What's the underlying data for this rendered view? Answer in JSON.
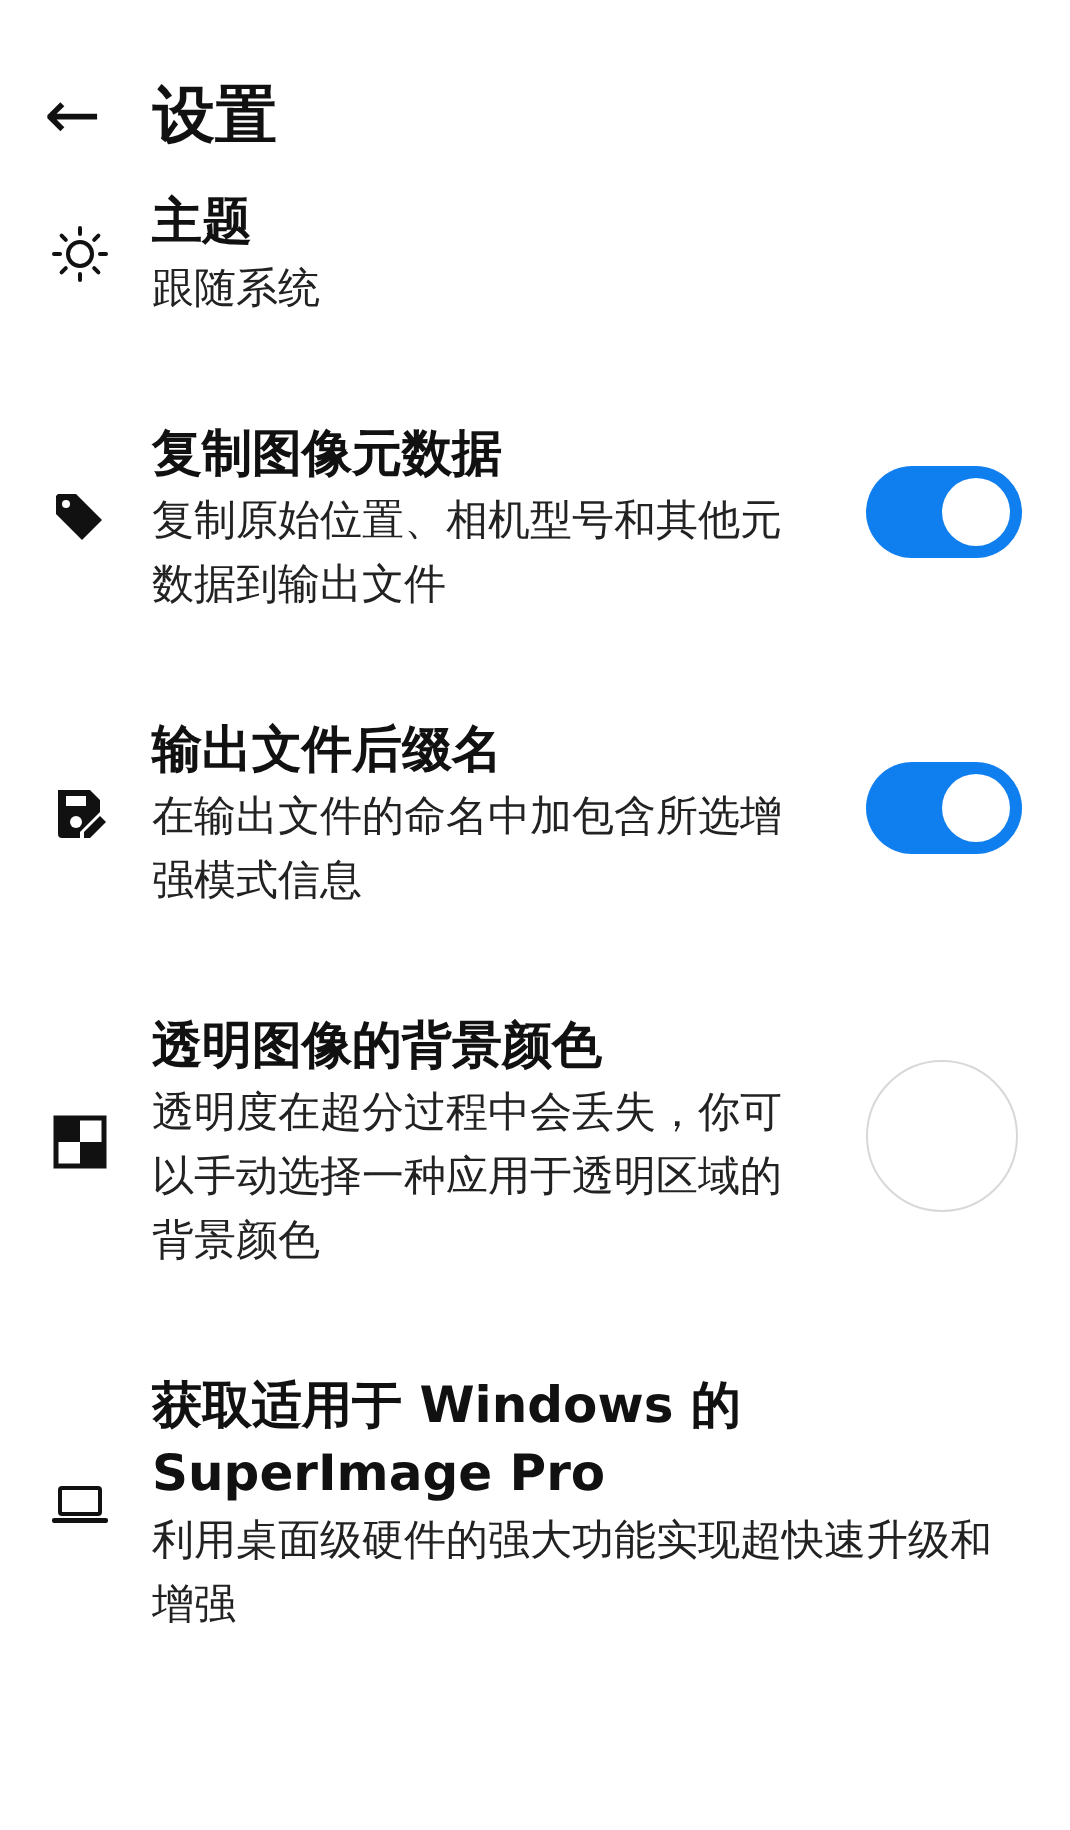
{
  "header": {
    "back": "←",
    "title": "设置"
  },
  "settings": [
    {
      "kind": "plain",
      "title": "主题",
      "description": "跟随系统"
    },
    {
      "kind": "switch",
      "title": "复制图像元数据",
      "description": "复制原始位置、相机型号和其他元数据到输出文件",
      "on": true
    },
    {
      "kind": "switch",
      "title": "输出文件后缀名",
      "description": "在输出文件的命名中加包含所选增强模式信息",
      "on": true
    },
    {
      "kind": "color",
      "title": "透明图像的背景颜色",
      "description": "透明度在超分过程中会丢失，你可以手动选择一种应用于透明区域的背景颜色",
      "color": "#ffffff"
    },
    {
      "kind": "plain",
      "title": "获取适用于 Windows 的 SuperImage Pro",
      "description": "利用桌面级硬件的强大功能实现超快速升级和增强"
    }
  ]
}
